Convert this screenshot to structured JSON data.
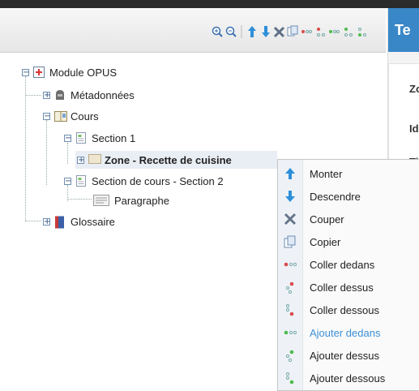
{
  "right_panel": {
    "header": "Te",
    "row1": "Zo",
    "row2": "Id",
    "row3": "Ti"
  },
  "toolbar": {
    "icons": [
      "zoom-in-icon",
      "zoom-out-icon",
      "move-up-icon",
      "move-down-icon",
      "cut-icon",
      "copy-icon",
      "paste-into-icon",
      "paste-above-icon",
      "add-into-icon",
      "add-above-icon",
      "add-below-icon"
    ]
  },
  "tree": {
    "module": "Module OPUS",
    "metadata": "Métadonnées",
    "cours": "Cours",
    "section1": "Section 1",
    "zone": "Zone - Recette de cuisine",
    "section2": "Section de cours - Section 2",
    "paragraphe": "Paragraphe",
    "glossaire": "Glossaire"
  },
  "context_menu": {
    "items": [
      {
        "label": "Monter",
        "icon": "arrow-up-icon"
      },
      {
        "label": "Descendre",
        "icon": "arrow-down-icon"
      },
      {
        "label": "Couper",
        "icon": "scissors-icon"
      },
      {
        "label": "Copier",
        "icon": "copy-icon"
      },
      {
        "label": "Coller dedans",
        "icon": "paste-into-icon"
      },
      {
        "label": "Coller dessus",
        "icon": "paste-above-icon"
      },
      {
        "label": "Coller dessous",
        "icon": "paste-below-icon"
      },
      {
        "label": "Ajouter dedans",
        "icon": "add-into-icon"
      },
      {
        "label": "Ajouter dessus",
        "icon": "add-above-icon"
      },
      {
        "label": "Ajouter dessous",
        "icon": "add-below-icon"
      }
    ]
  }
}
